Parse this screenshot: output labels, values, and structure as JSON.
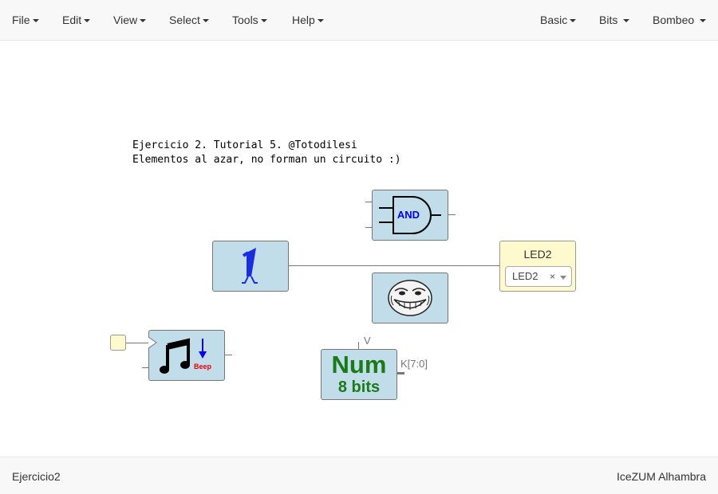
{
  "menu_left": {
    "file": "File",
    "edit": "Edit",
    "view": "View",
    "select": "Select",
    "tools": "Tools",
    "help": "Help"
  },
  "menu_right": {
    "basic": "Basic",
    "bits": "Bits",
    "bombeo": "Bombeo"
  },
  "canvas": {
    "comment_line1": "Ejercicio 2. Tutorial 5. @Totodilesi",
    "comment_line2": "Elementos al azar, no forman un circuito :)",
    "and_gate_label": "AND",
    "led_block": {
      "title": "LED2",
      "selected_value": "LED2",
      "clear_symbol": "×"
    },
    "beep_label": "Beep",
    "num_block": {
      "title": "Num",
      "subtitle": "8 bits",
      "input_label": "V",
      "output_label": "K[7:0]"
    }
  },
  "icons": {
    "and": "and-gate-icon",
    "walking_one": "walking-one-icon",
    "troll": "troll-face-icon",
    "music": "music-note-icon",
    "beep_arrow": "down-arrow-icon"
  },
  "colors": {
    "block_fill": "#c1dde9",
    "io_fill": "#fffacd",
    "num_text": "#1a7a1a",
    "and_text": "#0000ee",
    "beep_text": "#ee0000"
  },
  "footer": {
    "project_name": "Ejercicio2",
    "board": "IceZUM Alhambra"
  }
}
